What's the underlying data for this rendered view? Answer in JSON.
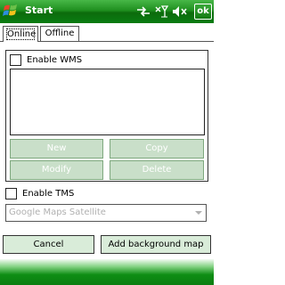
{
  "titlebar": {
    "title": "Start",
    "ok_label": "ok",
    "icons": [
      "windows-logo",
      "connectivity-icon",
      "signal-off-icon",
      "volume-mute-icon"
    ]
  },
  "tabs": [
    {
      "label": "Online",
      "active": true
    },
    {
      "label": "Offline",
      "active": false
    }
  ],
  "wms": {
    "checkbox_label": "Enable WMS",
    "checked": false,
    "buttons": {
      "new": "New",
      "copy": "Copy",
      "modify": "Modify",
      "delete": "Delete"
    }
  },
  "tms": {
    "checkbox_label": "Enable TMS",
    "checked": false,
    "selected_option": "Google Maps Satellite"
  },
  "footer": {
    "cancel": "Cancel",
    "add_background_map": "Add background map"
  },
  "colors": {
    "titlebar_green": "#1f8f1f",
    "button_fill": "#d9ecd9",
    "disabled_button_fill": "#c9dfc9"
  }
}
